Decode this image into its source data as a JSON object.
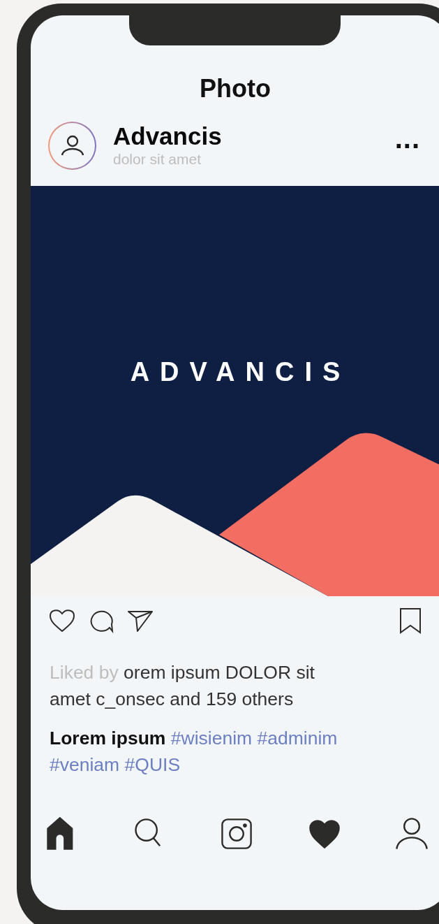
{
  "screen": {
    "title": "Photo"
  },
  "post": {
    "author": "Advancis",
    "subtitle": "dolor sit amet",
    "more": "...",
    "image": {
      "wordmark": "ADVANCIS"
    },
    "likes": {
      "prefix": "Liked by",
      "text": "orem ipsum DOLOR sit amet c_onsec and 159 others"
    },
    "caption": {
      "author": "Lorem ipsum",
      "hashtags": [
        "#wisienim",
        "#adminim",
        "#veniam",
        "#QUIS"
      ]
    }
  },
  "nav": [
    {
      "kind": "home",
      "filled": true
    },
    {
      "kind": "search",
      "filled": false
    },
    {
      "kind": "camera",
      "filled": false
    },
    {
      "kind": "heart",
      "filled": true
    },
    {
      "kind": "profile",
      "filled": false
    }
  ]
}
